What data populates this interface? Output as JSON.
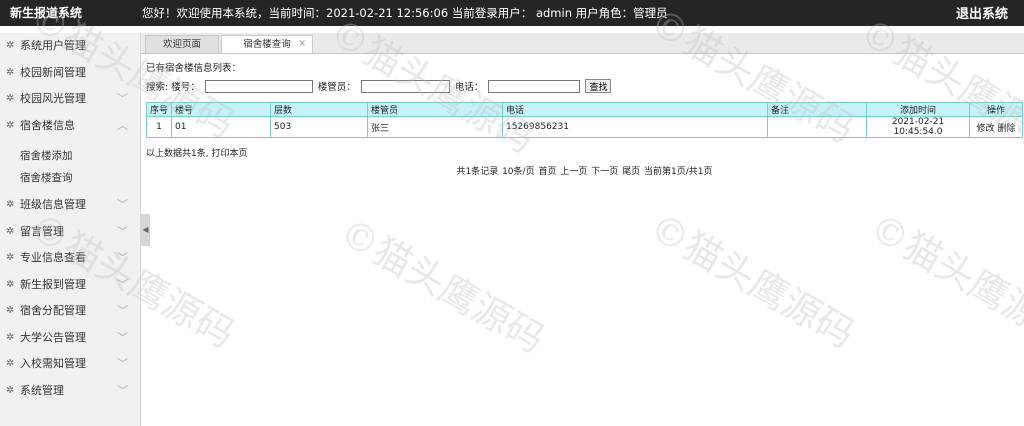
{
  "header": {
    "app_title": "新生报道系统",
    "welcome_text": "您好！欢迎使用本系统，当前时间：2021-02-21 12:56:06    当前登录用户： admin  用户角色：管理员",
    "logout_label": "退出系统"
  },
  "sidebar": {
    "items": [
      {
        "label": "系统用户管理"
      },
      {
        "label": "校园新闻管理"
      },
      {
        "label": "校园风光管理"
      },
      {
        "label": "宿舍楼信息"
      },
      {
        "label": "班级信息管理"
      },
      {
        "label": "留言管理"
      },
      {
        "label": "专业信息查看"
      },
      {
        "label": "新生报到管理"
      },
      {
        "label": "宿舍分配管理"
      },
      {
        "label": "大学公告管理"
      },
      {
        "label": "入校需知管理"
      },
      {
        "label": "系统管理"
      }
    ],
    "sub_items": [
      {
        "label": "宿舍楼添加"
      },
      {
        "label": "宿舍楼查询"
      }
    ]
  },
  "tabs": {
    "welcome": "欢迎页面",
    "active": "宿舍楼查询"
  },
  "content": {
    "list_title": "已有宿舍楼信息列表：",
    "search": {
      "prefix": "搜索:",
      "label_building": "楼号：",
      "label_manager": "楼管员：",
      "label_phone": "电话：",
      "button": "查找"
    },
    "table": {
      "headers": [
        "序号",
        "楼号",
        "层数",
        "楼管员",
        "电话",
        "备注",
        "添加时间",
        "操作"
      ],
      "rows": [
        {
          "index": "1",
          "building": "01",
          "floors": "503",
          "manager": "张三",
          "phone": "15269856231",
          "note": "",
          "time": "2021-02-21 10:45:54.0",
          "edit": "修改",
          "delete": "删除"
        }
      ]
    },
    "summary": {
      "text": "以上数据共1条,",
      "print": "打印本页"
    },
    "pager": {
      "total": "共1条记录",
      "per_page": "10条/页",
      "first": "首页",
      "prev": "上一页",
      "next": "下一页",
      "last": "尾页",
      "current": "当前第1页/共1页"
    }
  },
  "watermark": "©猫头鹰源码"
}
